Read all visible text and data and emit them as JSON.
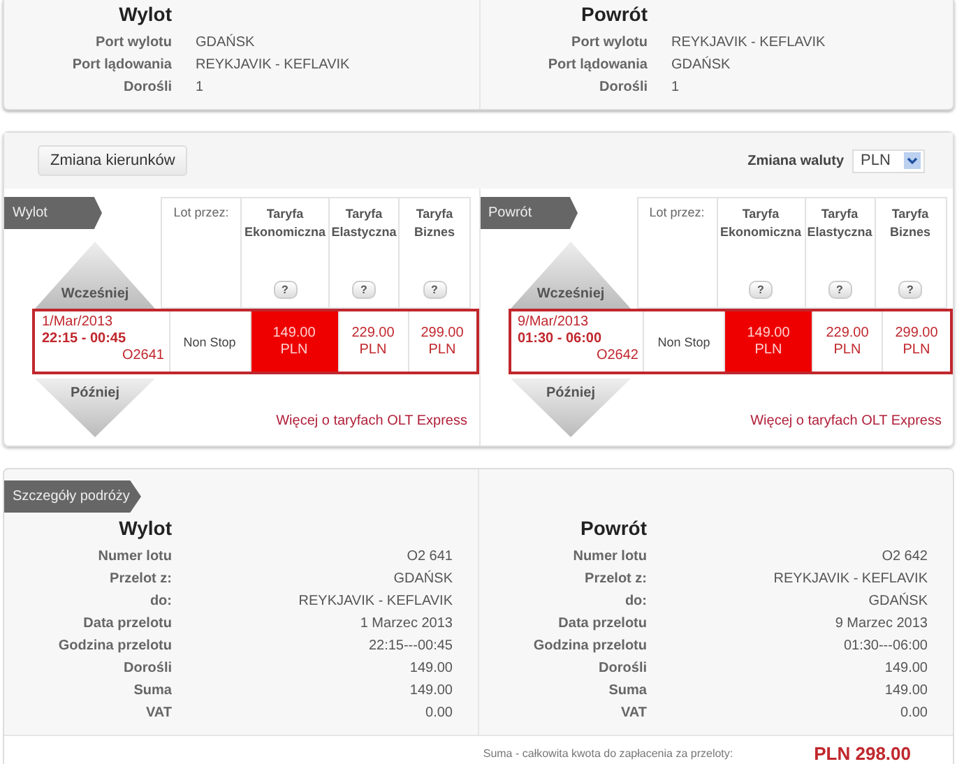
{
  "summary": [
    {
      "title": "Wylot",
      "rows": [
        {
          "label": "Port wylotu",
          "value": "GDAŃSK"
        },
        {
          "label": "Port lądowania",
          "value": "REYKJAVIK - KEFLAVIK"
        },
        {
          "label": "Dorośli",
          "value": "1"
        }
      ]
    },
    {
      "title": "Powrót",
      "rows": [
        {
          "label": "Port wylotu",
          "value": "REYKJAVIK - KEFLAVIK"
        },
        {
          "label": "Port lądowania",
          "value": "GDAŃSK"
        },
        {
          "label": "Dorośli",
          "value": "1"
        }
      ]
    }
  ],
  "toolbar": {
    "change_button": "Zmiana kierunków",
    "currency_label": "Zmiana waluty",
    "currency": "PLN"
  },
  "flights": [
    {
      "tag": "Wylot",
      "earlier": "Wcześniej",
      "later": "Później",
      "via_header": "Lot przez:",
      "fare_headers": [
        "Taryfa Ekonomiczna",
        "Taryfa Elastyczna",
        "Taryfa Biznes"
      ],
      "help": [
        "?",
        "?",
        "?"
      ],
      "date": "1/Mar/2013",
      "time": "22:15 - 00:45",
      "number": "O2641",
      "via": "Non Stop",
      "fares": [
        {
          "price": "149.00",
          "currency": "PLN",
          "selected": true
        },
        {
          "price": "229.00",
          "currency": "PLN",
          "selected": false
        },
        {
          "price": "299.00",
          "currency": "PLN",
          "selected": false
        }
      ],
      "link": "Więcej o taryfach OLT Express"
    },
    {
      "tag": "Powrót",
      "earlier": "Wcześniej",
      "later": "Później",
      "via_header": "Lot przez:",
      "fare_headers": [
        "Taryfa Ekonomiczna",
        "Taryfa Elastyczna",
        "Taryfa Biznes"
      ],
      "help": [
        "?",
        "?",
        "?"
      ],
      "date": "9/Mar/2013",
      "time": "01:30 - 06:00",
      "number": "O2642",
      "via": "Non Stop",
      "fares": [
        {
          "price": "149.00",
          "currency": "PLN",
          "selected": true
        },
        {
          "price": "229.00",
          "currency": "PLN",
          "selected": false
        },
        {
          "price": "299.00",
          "currency": "PLN",
          "selected": false
        }
      ],
      "link": "Więcej o taryfach OLT Express"
    }
  ],
  "details": {
    "tag": "Szczegóły podróży",
    "columns": [
      {
        "title": "Wylot",
        "rows": [
          {
            "label": "Numer lotu",
            "value": "O2 641"
          },
          {
            "label": "Przelot z:",
            "value": "GDAŃSK"
          },
          {
            "label": "do:",
            "value": "REYKJAVIK - KEFLAVIK"
          },
          {
            "label": "Data przelotu",
            "value": "1 Marzec 2013"
          },
          {
            "label": "Godzina przelotu",
            "value": "22:15---00:45"
          },
          {
            "label": "Dorośli",
            "value": "149.00"
          },
          {
            "label": "Suma",
            "value": "149.00"
          },
          {
            "label": "VAT",
            "value": "0.00"
          }
        ]
      },
      {
        "title": "Powrót",
        "rows": [
          {
            "label": "Numer lotu",
            "value": "O2 642"
          },
          {
            "label": "Przelot z:",
            "value": "REYKJAVIK - KEFLAVIK"
          },
          {
            "label": "do:",
            "value": "GDAŃSK"
          },
          {
            "label": "Data przelotu",
            "value": "9 Marzec 2013"
          },
          {
            "label": "Godzina przelotu",
            "value": "01:30---06:00"
          },
          {
            "label": "Dorośli",
            "value": "149.00"
          },
          {
            "label": "Suma",
            "value": "149.00"
          },
          {
            "label": "VAT",
            "value": "0.00"
          }
        ]
      }
    ],
    "total_label": "Suma - całkowita kwota do zapłacenia za przeloty:",
    "total": "PLN 298.00"
  }
}
